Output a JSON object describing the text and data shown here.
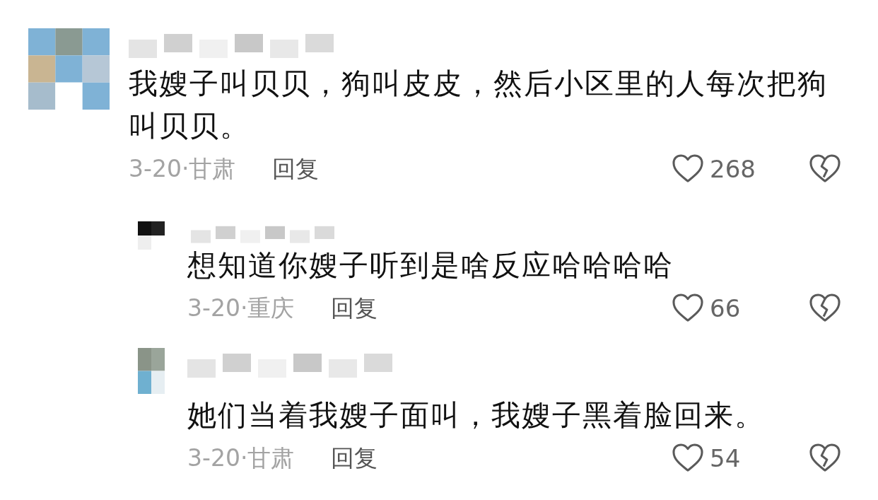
{
  "comments": [
    {
      "kind": "top",
      "text": "我嫂子叫贝贝，狗叫皮皮，然后小区里的人每次把狗叫贝贝。",
      "meta": "3-20·甘肃",
      "reply": "回复",
      "likes": "268"
    },
    {
      "kind": "reply",
      "text": "想知道你嫂子听到是啥反应哈哈哈哈",
      "meta": "3-20·重庆",
      "reply": "回复",
      "likes": "66"
    },
    {
      "kind": "reply",
      "text": "她们当着我嫂子面叫，我嫂子黑着脸回来。",
      "meta": "3-20·甘肃",
      "reply": "回复",
      "likes": "54"
    }
  ]
}
